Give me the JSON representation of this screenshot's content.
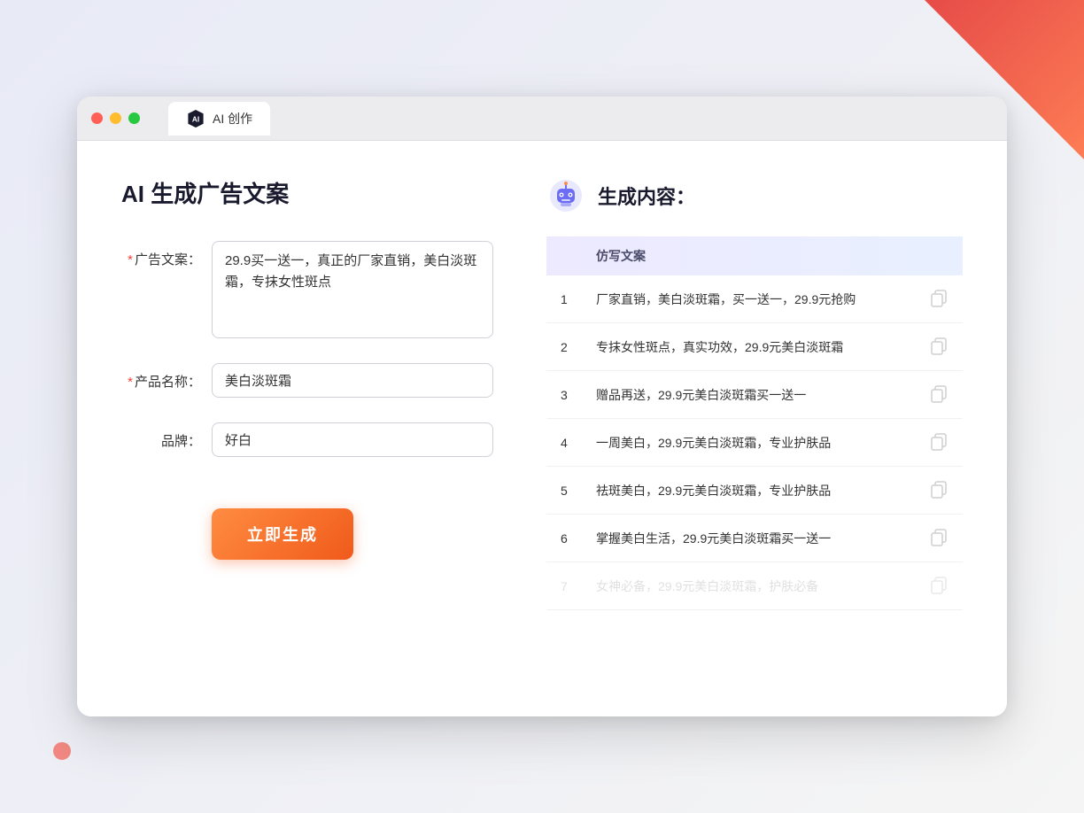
{
  "window": {
    "tab_label": "AI 创作"
  },
  "left_panel": {
    "title": "AI 生成广告文案",
    "ad_copy_label": "广告文案：",
    "ad_copy_required": "*",
    "ad_copy_value": "29.9买一送一，真正的厂家直销，美白淡斑霜，专抹女性斑点",
    "product_name_label": "产品名称：",
    "product_name_required": "*",
    "product_name_value": "美白淡斑霜",
    "brand_label": "品牌：",
    "brand_value": "好白",
    "generate_btn_label": "立即生成"
  },
  "right_panel": {
    "title": "生成内容：",
    "column_header": "仿写文案",
    "results": [
      {
        "num": "1",
        "text": "厂家直销，美白淡斑霜，买一送一，29.9元抢购"
      },
      {
        "num": "2",
        "text": "专抹女性斑点，真实功效，29.9元美白淡斑霜"
      },
      {
        "num": "3",
        "text": "赠品再送，29.9元美白淡斑霜买一送一"
      },
      {
        "num": "4",
        "text": "一周美白，29.9元美白淡斑霜，专业护肤品"
      },
      {
        "num": "5",
        "text": "祛斑美白，29.9元美白淡斑霜，专业护肤品"
      },
      {
        "num": "6",
        "text": "掌握美白生活，29.9元美白淡斑霜买一送一"
      },
      {
        "num": "7",
        "text": "女神必备，29.9元美白淡斑霜，护肤必备",
        "faded": true
      }
    ]
  }
}
